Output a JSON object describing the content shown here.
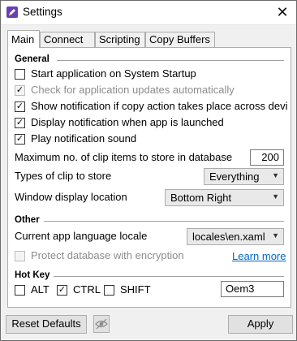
{
  "window": {
    "title": "Settings",
    "close_icon": "close-icon",
    "app_icon": "settings-pencil-icon"
  },
  "tabs": [
    {
      "label": "Main",
      "active": true
    },
    {
      "label": "Connect",
      "active": false
    },
    {
      "label": "Scripting",
      "active": false
    },
    {
      "label": "Copy Buffers",
      "active": false
    }
  ],
  "general": {
    "heading": "General",
    "options": [
      {
        "label": "Start application on System Startup",
        "checked": false,
        "enabled": true
      },
      {
        "label": "Check for application updates automatically",
        "checked": true,
        "enabled": false
      },
      {
        "label": "Show notification if copy action takes place across devi",
        "checked": true,
        "enabled": true
      },
      {
        "label": "Display notification when app is launched",
        "checked": true,
        "enabled": true
      },
      {
        "label": "Play notification sound",
        "checked": true,
        "enabled": true
      }
    ],
    "max_clip_label": "Maximum no. of clip items to store in database",
    "max_clip_value": "200",
    "clip_types_label": "Types of clip to store",
    "clip_types_value": "Everything",
    "window_location_label": "Window display location",
    "window_location_value": "Bottom Right"
  },
  "other": {
    "heading": "Other",
    "locale_label": "Current app language locale",
    "locale_value": "locales\\en.xaml",
    "protect_label": "Protect database with encryption",
    "protect_checked": false,
    "protect_enabled": false,
    "learn_more": "Learn more"
  },
  "hotkey": {
    "heading": "Hot Key",
    "alt": {
      "label": "ALT",
      "checked": false
    },
    "ctrl": {
      "label": "CTRL",
      "checked": true
    },
    "shift": {
      "label": "SHIFT",
      "checked": false
    },
    "key_value": "Oem3"
  },
  "footer": {
    "reset_label": "Reset Defaults",
    "eye_icon": "eye-slash-icon",
    "apply_label": "Apply"
  },
  "colors": {
    "link": "#0066cc",
    "panel": "#ffffff",
    "window_bg": "#f0f0f0"
  }
}
